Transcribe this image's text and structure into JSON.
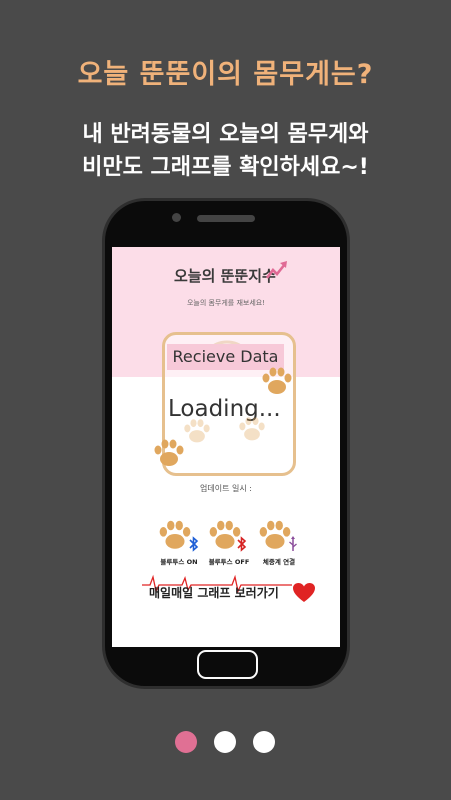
{
  "headline": "오늘 뚠뚠이의 몸무게는?",
  "subline_1": "내 반려동물의 오늘의 몸무게와",
  "subline_2": "비만도 그래프를 확인하세요~!",
  "app": {
    "logo_text": "오늘의 뚠뚠지수",
    "subtitle": "오늘의 몸무게를 재보세요!",
    "data_header": "Recieve Data",
    "loading_text": "Loading...",
    "update_label": "업데이트 일시 :",
    "buttons": {
      "bt_on": "블루투스 ON",
      "bt_off": "블루투스 OFF",
      "scale": "체중계 연결"
    },
    "graph_link": "매일매일 그래프 보러가기"
  },
  "pagination": {
    "total": 3,
    "active": 1
  },
  "colors": {
    "background": "#4a4a4a",
    "headline": "#f0b27a",
    "pink": "#fcdde8",
    "paw": "#e0a75e",
    "heart": "#e02424",
    "active_dot": "#e07094"
  }
}
